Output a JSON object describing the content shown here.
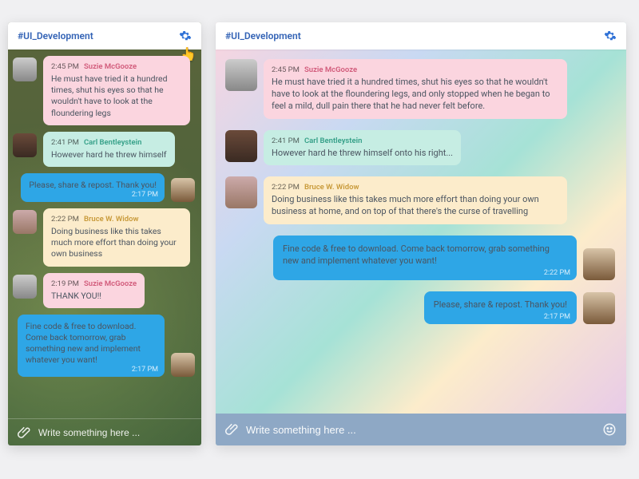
{
  "channel_title": "#UI_Development",
  "composer_placeholder": "Write something here ...",
  "mobile": {
    "messages": [
      {
        "kind": "in",
        "tone": "pink",
        "avatar": "a",
        "time": "2:45 PM",
        "name": "Suzie McGooze",
        "text": "He must have tried it a hundred times, shut his eyes so that he wouldn't have to look at the floundering legs"
      },
      {
        "kind": "in",
        "tone": "mint",
        "avatar": "b",
        "time": "2:41 PM",
        "name": "Carl Bentleystein",
        "text": "However hard he threw himself"
      },
      {
        "kind": "out",
        "avatar": "d",
        "text": "Please, share & repost. Thank you!",
        "ts": "2:17 PM"
      },
      {
        "kind": "in",
        "tone": "cream",
        "avatar": "c",
        "time": "2:22 PM",
        "name": "Bruce W. Widow",
        "text": "Doing business like this takes much more effort than doing your own business"
      },
      {
        "kind": "in",
        "tone": "pink",
        "avatar": "a",
        "time": "2:19 PM",
        "name": "Suzie McGooze",
        "text": "THANK YOU!!"
      },
      {
        "kind": "out",
        "avatar": "d",
        "text": "Fine code & free to download. Come back tomorrow, grab something new and implement whatever you want!",
        "ts": "2:17 PM"
      }
    ]
  },
  "desktop": {
    "messages": [
      {
        "kind": "in",
        "tone": "pink",
        "avatar": "a",
        "time": "2:45 PM",
        "name": "Suzie McGooze",
        "text": "He must have tried it a hundred times, shut his eyes so that he wouldn't have to look at the floundering legs, and only stopped when he began to feel a mild, dull pain there that he had never felt before."
      },
      {
        "kind": "in",
        "tone": "mint",
        "avatar": "b",
        "time": "2:41 PM",
        "name": "Carl Bentleystein",
        "text": "However hard he threw himself onto his right..."
      },
      {
        "kind": "in",
        "tone": "cream",
        "avatar": "c",
        "time": "2:22 PM",
        "name": "Bruce W. Widow",
        "text": "Doing business like this takes much more effort than doing your own business at home, and on top of that there's the curse of travelling"
      },
      {
        "kind": "out",
        "avatar": "d",
        "text": "Fine code & free to download. Come back tomorrow, grab something new and implement whatever you want!",
        "ts": "2:22 PM"
      },
      {
        "kind": "out",
        "avatar": "d",
        "text": "Please, share & repost. Thank you!",
        "ts": "2:17 PM"
      }
    ]
  }
}
